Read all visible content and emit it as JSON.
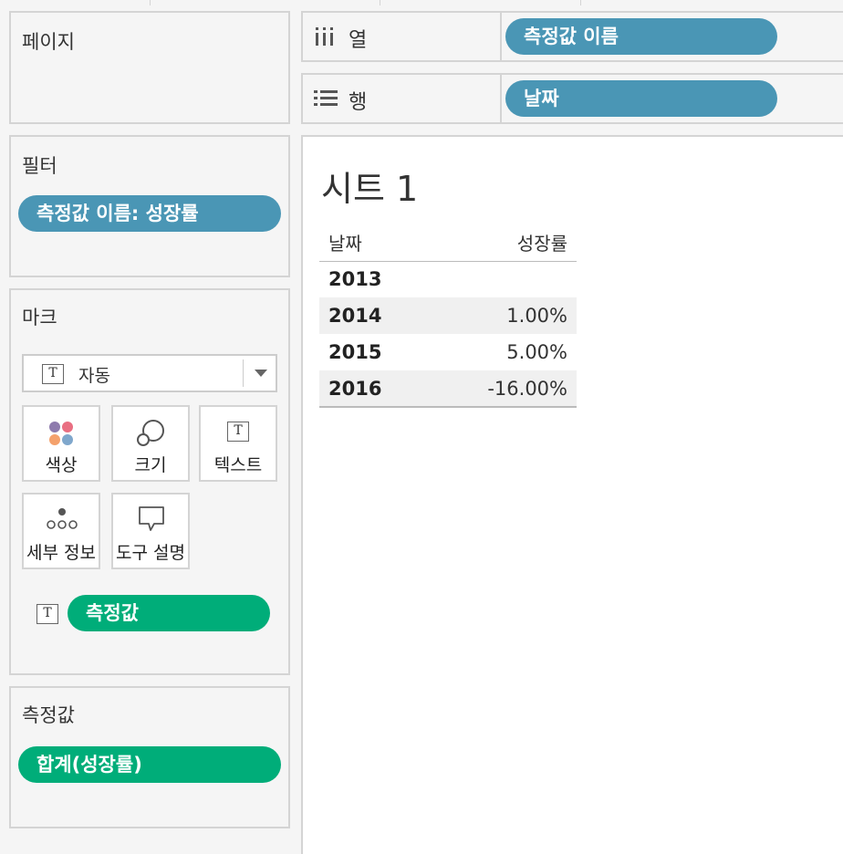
{
  "pages_panel": {
    "title": "페이지"
  },
  "filters_panel": {
    "title": "필터",
    "pills": [
      "측정값 이름: 성장률"
    ]
  },
  "marks_panel": {
    "title": "마크",
    "mark_type": "자동",
    "cards": {
      "color": "색상",
      "size": "크기",
      "text": "텍스트",
      "detail": "세부 정보",
      "tooltip": "도구 설명"
    },
    "text_pill": "측정값"
  },
  "measures_panel": {
    "title": "측정값",
    "pills": [
      "합계(성장률)"
    ]
  },
  "shelves": {
    "columns": {
      "label": "열",
      "pill": "측정값 이름"
    },
    "rows": {
      "label": "행",
      "pill": "날짜"
    }
  },
  "view": {
    "sheet_title": "시트 1",
    "table": {
      "headers": [
        "날짜",
        "성장률"
      ],
      "rows": [
        {
          "year": "2013",
          "value": ""
        },
        {
          "year": "2014",
          "value": "1.00%"
        },
        {
          "year": "2015",
          "value": "5.00%"
        },
        {
          "year": "2016",
          "value": "-16.00%"
        }
      ]
    }
  },
  "colors": {
    "dimension_pill": "#4a96b5",
    "measure_pill": "#00ad79"
  },
  "icons": [
    "columns-icon",
    "rows-icon",
    "color-icon",
    "size-icon",
    "text-icon",
    "detail-icon",
    "tooltip-icon",
    "dropdown-icon"
  ]
}
